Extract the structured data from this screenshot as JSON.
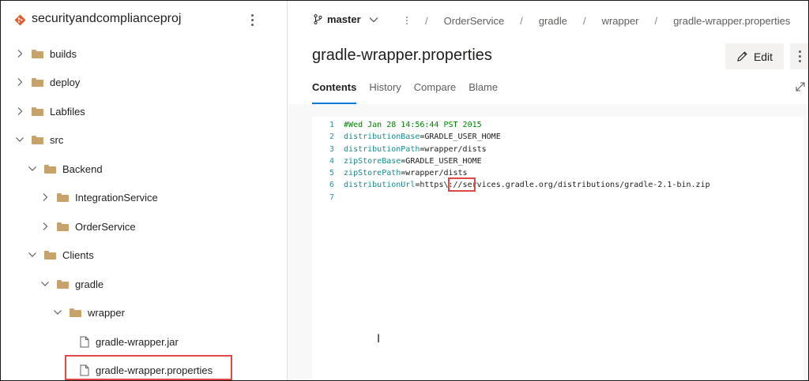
{
  "project": {
    "name": "securityandcomplianceproj"
  },
  "tree": [
    {
      "label": "builds",
      "type": "folder",
      "expanded": false,
      "depth": 0
    },
    {
      "label": "deploy",
      "type": "folder",
      "expanded": false,
      "depth": 0
    },
    {
      "label": "Labfiles",
      "type": "folder",
      "expanded": false,
      "depth": 0
    },
    {
      "label": "src",
      "type": "folder",
      "expanded": true,
      "depth": 0
    },
    {
      "label": "Backend",
      "type": "folder",
      "expanded": true,
      "depth": 1
    },
    {
      "label": "IntegrationService",
      "type": "folder",
      "expanded": false,
      "depth": 2
    },
    {
      "label": "OrderService",
      "type": "folder",
      "expanded": false,
      "depth": 2
    },
    {
      "label": "Clients",
      "type": "folder",
      "expanded": true,
      "depth": 1
    },
    {
      "label": "gradle",
      "type": "folder",
      "expanded": true,
      "depth": 2
    },
    {
      "label": "wrapper",
      "type": "folder",
      "expanded": true,
      "depth": 3
    },
    {
      "label": "gradle-wrapper.jar",
      "type": "file",
      "depth": 4
    },
    {
      "label": "gradle-wrapper.properties",
      "type": "file",
      "depth": 4,
      "selected": true
    }
  ],
  "header": {
    "branch": "master",
    "breadcrumbs": [
      "OrderService",
      "gradle",
      "wrapper",
      "gradle-wrapper.properties"
    ]
  },
  "file": {
    "title": "gradle-wrapper.properties",
    "edit_label": "Edit",
    "tabs": [
      "Contents",
      "History",
      "Compare",
      "Blame"
    ],
    "active_tab": "Contents"
  },
  "code": [
    {
      "n": "1",
      "comment": "#Wed Jan 28 14:56:44 PST 2015"
    },
    {
      "n": "2",
      "key": "distributionBase",
      "value": "=GRADLE_USER_HOME"
    },
    {
      "n": "3",
      "key": "distributionPath",
      "value": "=wrapper/dists"
    },
    {
      "n": "4",
      "key": "zipStoreBase",
      "value": "=GRADLE_USER_HOME"
    },
    {
      "n": "5",
      "key": "zipStorePath",
      "value": "=wrapper/dists"
    },
    {
      "n": "6",
      "key": "distributionUrl",
      "value": "=https\\://services.gradle.org/distributions/gradle-2.1-bin.zip"
    },
    {
      "n": "7"
    }
  ],
  "colors": {
    "accent": "#0078d4",
    "highlight": "#e04848",
    "folder": "#c8a26b"
  }
}
